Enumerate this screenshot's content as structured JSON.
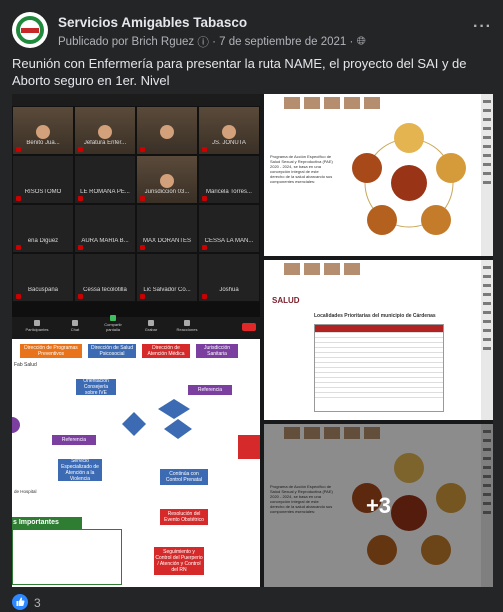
{
  "post": {
    "page_name": "Servicios Amigables Tabasco",
    "published_by": "Publicado por Brich Rguez",
    "date": "· 7 de septiembre de 2021 ·",
    "more": "···",
    "text": "Reunión con Enfermería para presentar la ruta NAME, el proyecto del SAI y de Aborto seguro en 1er. Nivel",
    "reactions": "3",
    "more_photos": "+3"
  },
  "zoom": {
    "tiles": [
      {
        "name": "Benito Jua..."
      },
      {
        "name": "Jefatura Enfer..."
      },
      {
        "name": ""
      },
      {
        "name": "JS. JONUTA"
      },
      {
        "name": "RISOSTOMO"
      },
      {
        "name": "LE ROMANA PE..."
      },
      {
        "name": "Jurisdiccion 03..."
      },
      {
        "name": "Maricela Torres..."
      },
      {
        "name": "ena Diguez"
      },
      {
        "name": "AURA MARIA B..."
      },
      {
        "name": "MAX DORANTES"
      },
      {
        "name": "CESSA LA MAN..."
      },
      {
        "name": "Bacuspana"
      },
      {
        "name": "Cessa tecolotilla"
      },
      {
        "name": "Lic Salvador Co..."
      },
      {
        "name": "Joshua"
      }
    ],
    "buttons": [
      "Participantes",
      "Chat",
      "Compartir pantalla",
      "Grabar",
      "Reacciones"
    ]
  },
  "slide1": {
    "heading": "Programa de Acción Específico de Salud Sexual y Reproductiva (PAE) 2020 - 2024, se basa en una concepción integral de este derecho de la salud abarcando sus componentes esenciales:"
  },
  "slide2": {
    "logo": "SALUD",
    "title": "Localidades Prioritarias del municipio de Cárdenas"
  },
  "flow": {
    "boxes": [
      {
        "label": "Dirección de Programas Preventivos",
        "color": "#e8731a"
      },
      {
        "label": "Dirección de Salud Psicosocial",
        "color": "#3d6bb3"
      },
      {
        "label": "Dirección de Atención Médica",
        "color": "#d62a2a"
      },
      {
        "label": "Jurisdicción Sanitaria",
        "color": "#7b3fa0"
      },
      {
        "label": "Orientación Consejería sobre IVE",
        "color": "#3d6bb3"
      },
      {
        "label": "Referencia",
        "color": "#7b3fa0"
      },
      {
        "label": "Referencia",
        "color": "#7b3fa0"
      },
      {
        "label": "Servicio Especializado de Atención a la Violencia",
        "color": "#3d6bb3"
      },
      {
        "label": "Continúa con Control Prenatal",
        "color": "#3d6bb3"
      },
      {
        "label": "Resolución del Evento Obstétrico",
        "color": "#d62a2a"
      },
      {
        "label": "Seguimiento y Control del Puerperio / Atención y Control del RN",
        "color": "#d62a2a"
      }
    ],
    "important": "s Importantes",
    "label_fab": "Fab Salud",
    "label_hosp": "de Hospital"
  }
}
